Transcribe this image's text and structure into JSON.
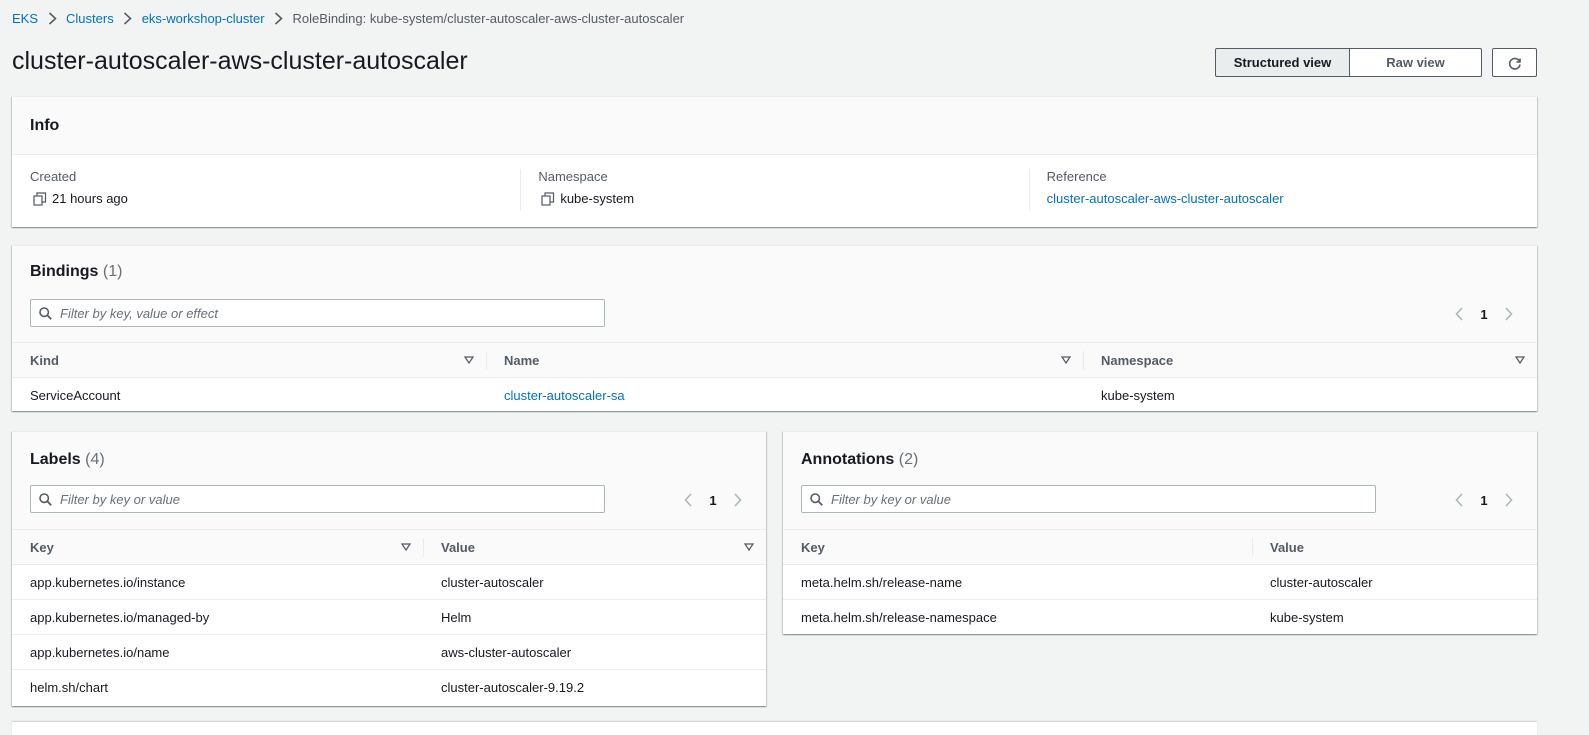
{
  "breadcrumb": [
    {
      "label": "EKS"
    },
    {
      "label": "Clusters"
    },
    {
      "label": "eks-workshop-cluster"
    },
    {
      "label": "RoleBinding: kube-system/cluster-autoscaler-aws-cluster-autoscaler"
    }
  ],
  "header": {
    "title": "cluster-autoscaler-aws-cluster-autoscaler",
    "structured_view_label": "Structured view",
    "raw_view_label": "Raw view"
  },
  "info": {
    "title": "Info",
    "created_label": "Created",
    "created_value": "21 hours ago",
    "namespace_label": "Namespace",
    "namespace_value": "kube-system",
    "reference_label": "Reference",
    "reference_value": "cluster-autoscaler-aws-cluster-autoscaler"
  },
  "bindings": {
    "title": "Bindings",
    "count": "(1)",
    "search_placeholder": "Filter by key, value or effect",
    "page": "1",
    "columns": [
      "Kind",
      "Name",
      "Namespace"
    ],
    "rows": [
      {
        "kind": "ServiceAccount",
        "name": "cluster-autoscaler-sa",
        "namespace": "kube-system"
      }
    ]
  },
  "labels": {
    "title": "Labels",
    "count": "(4)",
    "search_placeholder": "Filter by key or value",
    "page": "1",
    "columns": [
      "Key",
      "Value"
    ],
    "rows": [
      {
        "key": "app.kubernetes.io/instance",
        "value": "cluster-autoscaler"
      },
      {
        "key": "app.kubernetes.io/managed-by",
        "value": "Helm"
      },
      {
        "key": "app.kubernetes.io/name",
        "value": "aws-cluster-autoscaler"
      },
      {
        "key": "helm.sh/chart",
        "value": "cluster-autoscaler-9.19.2"
      }
    ]
  },
  "annotations": {
    "title": "Annotations",
    "count": "(2)",
    "search_placeholder": "Filter by key or value",
    "page": "1",
    "columns": [
      "Key",
      "Value"
    ],
    "rows": [
      {
        "key": "meta.helm.sh/release-name",
        "value": "cluster-autoscaler"
      },
      {
        "key": "meta.helm.sh/release-namespace",
        "value": "kube-system"
      }
    ]
  },
  "colors": {
    "link": "#0073bb",
    "text": "#16191f",
    "muted": "#545b64",
    "background": "#f2f3f3"
  },
  "icons": [
    "chevron-right-icon",
    "refresh-icon",
    "copy-icon",
    "search-icon",
    "chevron-left-icon",
    "sort-icon"
  ]
}
